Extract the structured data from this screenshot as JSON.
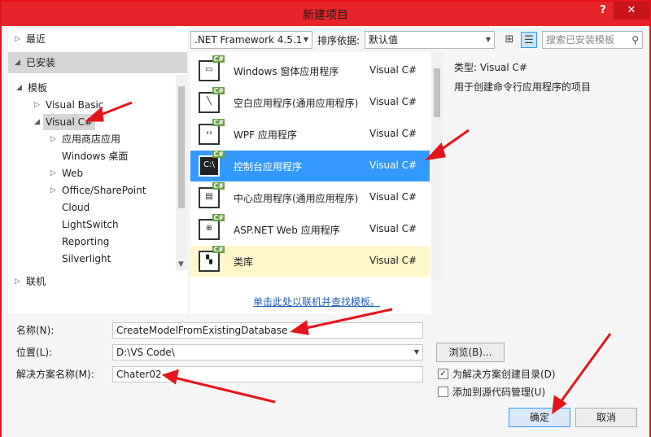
{
  "window": {
    "title": "新建项目",
    "help": "?",
    "close": "✕"
  },
  "left_pane": {
    "recent": "最近",
    "installed": "已安装",
    "templates": "模板",
    "tree": [
      {
        "label": "Visual Basic"
      },
      {
        "label": "Visual C#"
      },
      {
        "label": "应用商店应用"
      },
      {
        "label": "Windows 桌面"
      },
      {
        "label": "Web"
      },
      {
        "label": "Office/SharePoint"
      },
      {
        "label": "Cloud"
      },
      {
        "label": "LightSwitch"
      },
      {
        "label": "Reporting"
      },
      {
        "label": "Silverlight"
      }
    ],
    "online": "联机"
  },
  "toolbar": {
    "framework": ".NET Framework 4.5.1",
    "sort_label": "排序依据:",
    "sort_value": "默认值",
    "search_placeholder": "搜索已安装模板"
  },
  "templates": [
    {
      "icon": "window-icon",
      "name": "Windows 窗体应用程序",
      "lang": "Visual C#"
    },
    {
      "icon": "blank-app-icon",
      "name": "空白应用程序(通用应用程序)",
      "lang": "Visual C#"
    },
    {
      "icon": "wpf-icon",
      "name": "WPF 应用程序",
      "lang": "Visual C#"
    },
    {
      "icon": "console-icon",
      "name": "控制台应用程序",
      "lang": "Visual C#"
    },
    {
      "icon": "hub-app-icon",
      "name": "中心应用程序(通用应用程序)",
      "lang": "Visual C#"
    },
    {
      "icon": "web-app-icon",
      "name": "ASP.NET Web 应用程序",
      "lang": "Visual C#"
    },
    {
      "icon": "class-library-icon",
      "name": "类库",
      "lang": "Visual C#"
    }
  ],
  "online_link": "单击此处以联机并查找模板。",
  "detail": {
    "type_label": "类型:",
    "type_value": "Visual C#",
    "description": "用于创建命令行应用程序的项目"
  },
  "form": {
    "name_label": "名称(N):",
    "name_value": "CreateModelFromExistingDatabase",
    "location_label": "位置(L):",
    "location_value": "D:\\VS Code\\",
    "solution_label": "解决方案名称(M):",
    "solution_value": "Chater02",
    "browse": "浏览(B)...",
    "create_dir": "为解决方案创建目录(D)",
    "add_source_control": "添加到源代码管理(U)",
    "ok": "确定",
    "cancel": "取消"
  },
  "colors": {
    "accent": "#3399ff",
    "annotation": "#e5141a",
    "csharp_badge": "#68a044"
  }
}
